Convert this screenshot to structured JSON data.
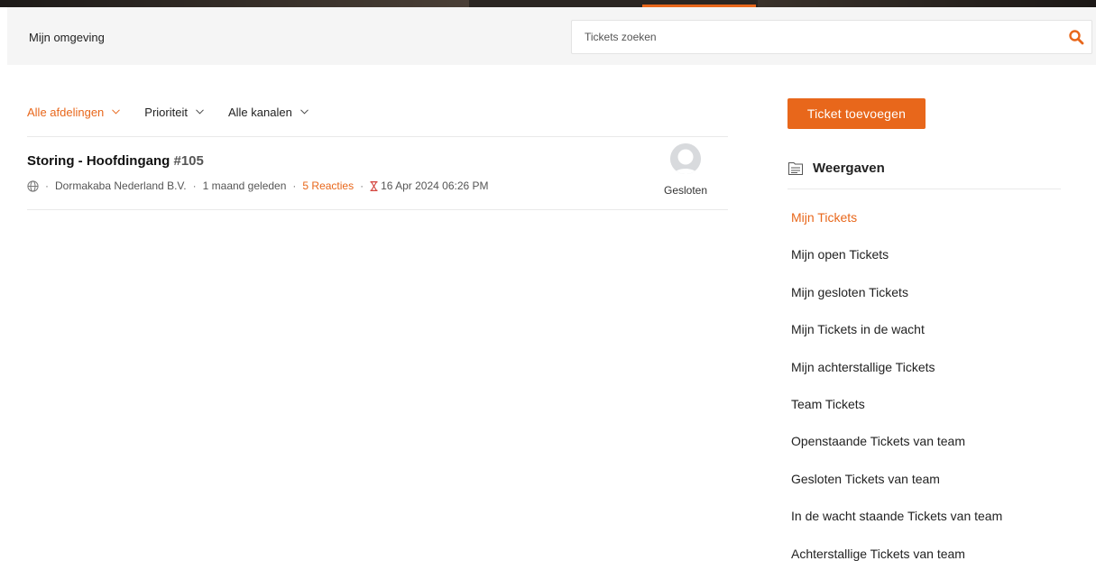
{
  "header": {
    "environment_label": "Mijn omgeving",
    "search_placeholder": "Tickets zoeken"
  },
  "filters": [
    {
      "label": "Alle afdelingen",
      "active": true
    },
    {
      "label": "Prioriteit",
      "active": false
    },
    {
      "label": "Alle kanalen",
      "active": false
    }
  ],
  "ticket": {
    "title": "Storing - Hoofdingang",
    "number": "#105",
    "company": "Dormakaba Nederland B.V.",
    "age": "1 maand geleden",
    "replies": "5 Reacties",
    "due": "16 Apr 2024 06:26 PM",
    "status": "Gesloten"
  },
  "sidebar": {
    "add_button": "Ticket toevoegen",
    "views_title": "Weergaven",
    "views": [
      "Mijn Tickets",
      "Mijn open Tickets",
      "Mijn gesloten Tickets",
      "Mijn Tickets in de wacht",
      "Mijn achterstallige Tickets",
      "Team Tickets",
      "Openstaande Tickets van team",
      "Gesloten Tickets van team",
      "In de wacht staande Tickets van team",
      "Achterstallige Tickets van team"
    ]
  },
  "colors": {
    "accent": "#e8671b",
    "header_bg": "#f5f5f5"
  },
  "icons": [
    "search-icon",
    "chevron-down-icon",
    "globe-icon",
    "hourglass-icon",
    "avatar-icon",
    "views-icon"
  ]
}
